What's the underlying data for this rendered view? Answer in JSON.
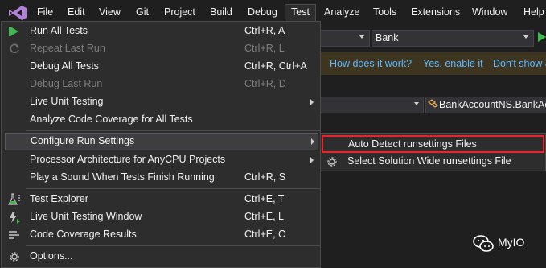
{
  "menubar": {
    "items": [
      "File",
      "Edit",
      "View",
      "Git",
      "Project",
      "Build",
      "Debug",
      "Test",
      "Analyze",
      "Tools",
      "Extensions",
      "Window",
      "Help"
    ],
    "active": "Test"
  },
  "background": {
    "toolbar_combo_value": "Bank",
    "banner_links": [
      "How does it work?",
      "Yes, enable it",
      "Don't show a"
    ],
    "nav_bar_value": "BankAccountNS.BankAcc"
  },
  "test_menu": {
    "items": [
      {
        "label": "Run All Tests",
        "shortcut": "Ctrl+R, A",
        "icon": "run-all-icon",
        "enabled": true
      },
      {
        "label": "Repeat Last Run",
        "shortcut": "Ctrl+R, L",
        "icon": "repeat-icon",
        "enabled": false
      },
      {
        "label": "Debug All Tests",
        "shortcut": "Ctrl+R, Ctrl+A",
        "enabled": true
      },
      {
        "label": "Debug Last Run",
        "shortcut": "Ctrl+R, D",
        "enabled": false
      },
      {
        "label": "Live Unit Testing",
        "submenu": true,
        "enabled": true
      },
      {
        "label": "Analyze Code Coverage for All Tests",
        "enabled": true
      },
      {
        "label": "Configure Run Settings",
        "submenu": true,
        "highlighted": true,
        "enabled": true
      },
      {
        "label": "Processor Architecture for AnyCPU Projects",
        "submenu": true,
        "enabled": true
      },
      {
        "label": "Play a Sound When Tests Finish Running",
        "shortcut": "Ctrl+R, S",
        "enabled": true
      },
      {
        "label": "Test Explorer",
        "shortcut": "Ctrl+E, T",
        "icon": "test-explorer-icon",
        "enabled": true
      },
      {
        "label": "Live Unit Testing Window",
        "shortcut": "Ctrl+E, L",
        "icon": "live-unit-testing-icon",
        "enabled": true
      },
      {
        "label": "Code Coverage Results",
        "shortcut": "Ctrl+E, C",
        "icon": "code-coverage-icon",
        "enabled": true
      },
      {
        "label": "Options...",
        "icon": "gear-icon",
        "enabled": true
      }
    ]
  },
  "configure_submenu": {
    "items": [
      {
        "label": "Auto Detect runsettings Files",
        "selected": true
      },
      {
        "label": "Select Solution Wide runsettings File",
        "icon": "gear-icon"
      }
    ]
  },
  "watermark": {
    "text": "MyIO"
  },
  "colors": {
    "accent_link": "#5fb8ff",
    "selection_outline": "#e8262a",
    "run_green": "#3fb950",
    "vs_purple": "#b180d7"
  }
}
